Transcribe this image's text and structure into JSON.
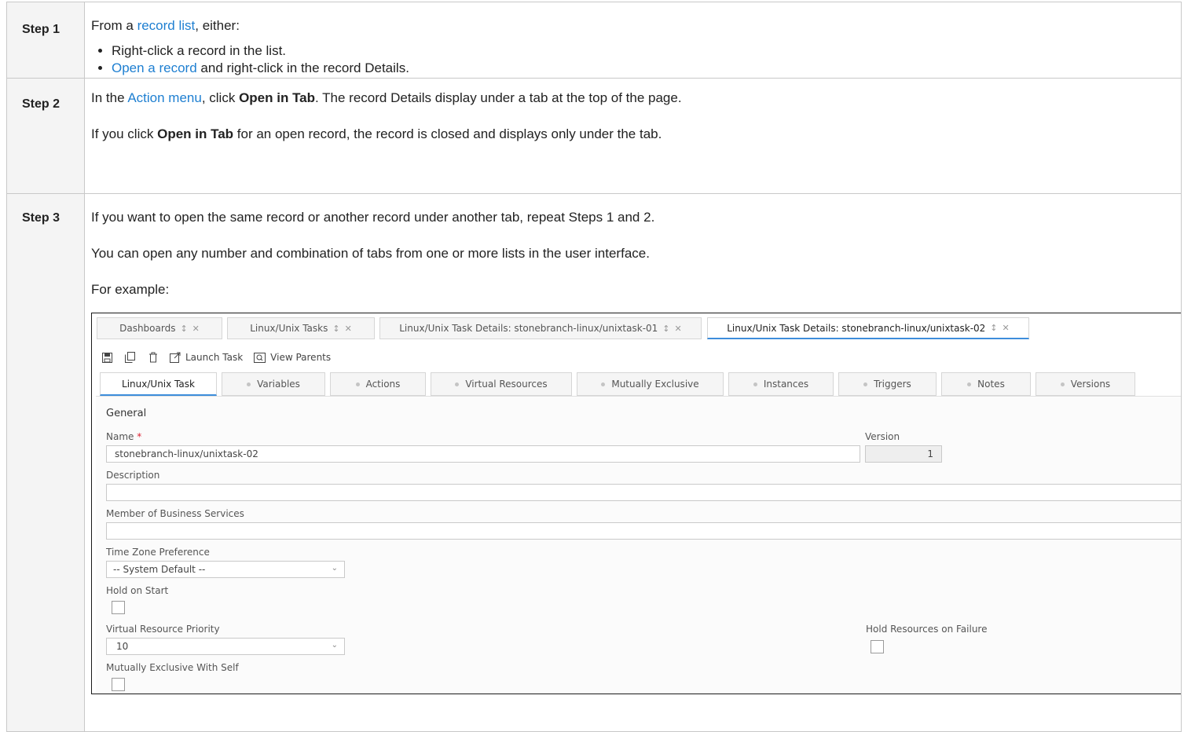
{
  "steps": [
    {
      "label": "Step 1",
      "intro_prefix": "From a ",
      "intro_link": "record list",
      "intro_suffix": ", either:",
      "bullets": [
        {
          "prefix": "",
          "link": "",
          "text": "Right-click a record in the list."
        },
        {
          "prefix": "",
          "link": "Open a record",
          "text": " and right-click in the record Details."
        }
      ]
    },
    {
      "label": "Step 2",
      "p1_prefix": "In the ",
      "p1_link": "Action menu",
      "p1_mid": ", click ",
      "p1_bold": "Open in Tab",
      "p1_suffix": ". The record Details display under a tab at the top of the page.",
      "p2_prefix": "If you click ",
      "p2_bold": "Open in Tab",
      "p2_suffix": " for an open record, the record is closed and displays only under the tab."
    },
    {
      "label": "Step 3",
      "p1": "If you want to open the same record or another record under another tab, repeat Steps 1 and 2.",
      "p2": "You can open any number and combination of tabs from one or more lists in the user interface.",
      "p3": "For example:"
    }
  ],
  "screenshot": {
    "page_tabs": [
      {
        "label": "Dashboards",
        "active": false
      },
      {
        "label": "Linux/Unix Tasks",
        "active": false
      },
      {
        "label": "Linux/Unix Task Details: stonebranch-linux/unixtask-01",
        "active": false
      },
      {
        "label": "Linux/Unix Task Details: stonebranch-linux/unixtask-02",
        "active": true
      }
    ],
    "toolbar": {
      "launch_task": "Launch Task",
      "view_parents": "View Parents"
    },
    "record_tabs": [
      "Linux/Unix Task",
      "Variables",
      "Actions",
      "Virtual Resources",
      "Mutually Exclusive",
      "Instances",
      "Triggers",
      "Notes",
      "Versions"
    ],
    "form": {
      "section": "General",
      "name_label": "Name",
      "required_mark": "*",
      "name_value": "stonebranch-linux/unixtask-02",
      "version_label": "Version",
      "version_value": "1",
      "description_label": "Description",
      "description_value": "",
      "member_label": "Member of Business Services",
      "member_value": "",
      "tz_label": "Time Zone Preference",
      "tz_value": "-- System Default --",
      "hold_start_label": "Hold on Start",
      "vr_priority_label": "Virtual Resource Priority",
      "vr_priority_value": "10",
      "hold_resources_label": "Hold Resources on Failure",
      "mutex_self_label": "Mutually Exclusive With Self"
    }
  },
  "colors": {
    "link": "#1e7fd1",
    "tab_accent": "#3d8ddb",
    "required": "#dd2233"
  }
}
